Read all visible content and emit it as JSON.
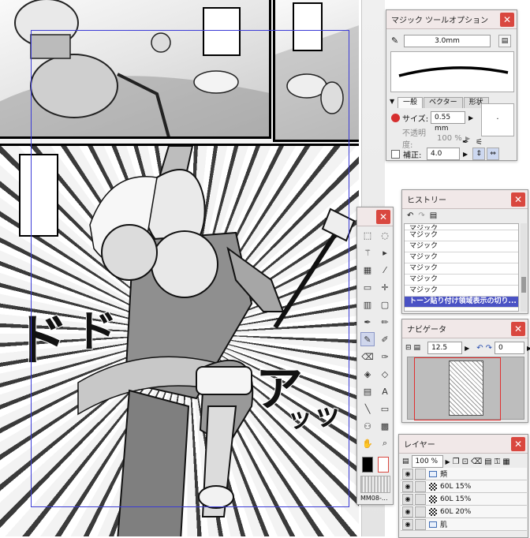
{
  "canvas": {
    "sfx": [
      "ダ",
      "ド",
      "ド",
      "ア",
      "ッ",
      "ッ"
    ]
  },
  "magic_tool_options": {
    "title": "マジック ツールオプション",
    "brush_size_field": "3.0mm",
    "tabs": [
      "一般",
      "ベクター",
      "形状"
    ],
    "size_label": "サイズ:",
    "size_value": "0.55 mm",
    "opacity_label": "不透明度:",
    "opacity_value": "100 %",
    "correction_label": "補正:",
    "correction_value": "4.0",
    "close_icon": "close-icon",
    "accent_color": "#d9473f"
  },
  "history": {
    "title": "ヒストリー",
    "items": [
      "マジック",
      "マジック",
      "マジック",
      "マジック",
      "マジック",
      "マジック",
      "マジック"
    ],
    "selected_item": "トーン貼り付け領域表示の切り..."
  },
  "tools": {
    "icons": [
      "marquee-icon",
      "lasso-icon",
      "magic-wand-icon",
      "pointer-icon",
      "fill-icon",
      "eyedropper-icon",
      "ruler-icon",
      "move-icon",
      "grid-icon",
      "frame-icon",
      "pen-icon",
      "pencil-icon",
      "marker-icon",
      "brush-icon",
      "eraser-icon",
      "brush2-icon",
      "fill-bucket-icon",
      "bucket2-icon",
      "gradient-icon",
      "text-icon",
      "line-icon",
      "rect-icon",
      "stamp-icon",
      "tone-icon",
      "hand-icon",
      "zoom-icon"
    ],
    "text_glyph": "A",
    "filename": "MM08-..."
  },
  "navigator": {
    "title": "ナビゲータ",
    "zoom_value": "12.5",
    "rotation_value": "0"
  },
  "layers": {
    "title": "レイヤー",
    "opacity_value": "100 %",
    "rows": [
      {
        "name": "頬",
        "type": "folder"
      },
      {
        "name": "60L 15%",
        "type": "tone"
      },
      {
        "name": "60L 15%",
        "type": "tone"
      },
      {
        "name": "60L 20%",
        "type": "tone"
      },
      {
        "name": "肌",
        "type": "folder"
      }
    ]
  }
}
